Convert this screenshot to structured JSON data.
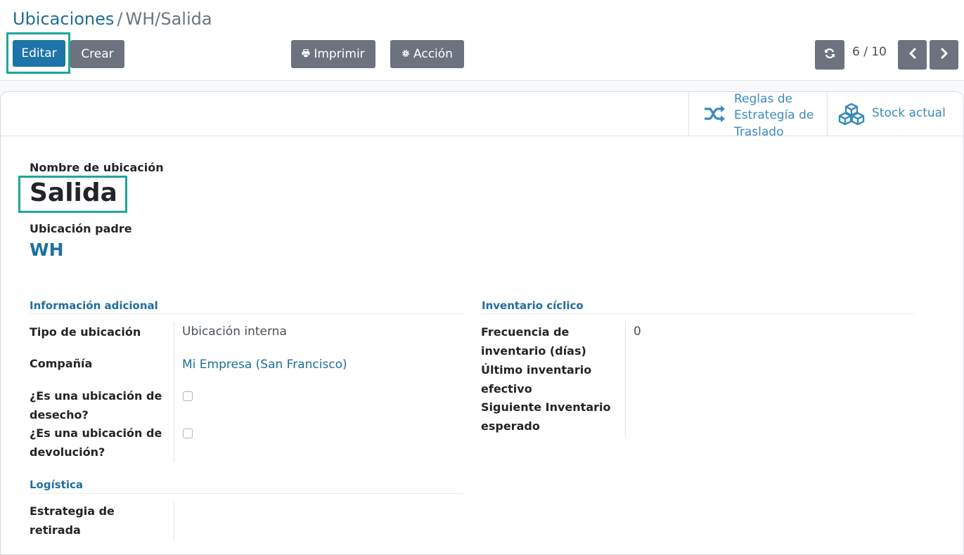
{
  "breadcrumb": {
    "parent": "Ubicaciones",
    "separator": "/",
    "current": "WH/Salida"
  },
  "toolbar": {
    "edit_label": "Editar",
    "create_label": "Crear",
    "print_label": "Imprimir",
    "action_label": "Acción",
    "print_icon": "printer-icon",
    "action_icon": "gear-icon"
  },
  "pager": {
    "value": "6 / 10",
    "refresh_icon": "refresh-icon",
    "prev_icon": "chevron-left-icon",
    "next_icon": "chevron-right-icon"
  },
  "smart_buttons": {
    "putaway_label": "Reglas de Estrategía de Traslado",
    "putaway_icon": "shuffle-icon",
    "stock_label": "Stock actual",
    "stock_icon": "cubes-icon"
  },
  "form": {
    "name_label": "Nombre de ubicación",
    "name_value": "Salida",
    "parent_label": "Ubicación padre",
    "parent_value": "WH"
  },
  "info_group": {
    "title": "Información adicional",
    "location_type_label": "Tipo de ubicación",
    "location_type_value": "Ubicación interna",
    "company_label": "Compañía",
    "company_value": "Mi Empresa (San Francisco)",
    "scrap_label": "¿Es una ubicación de desecho?",
    "scrap_checked": false,
    "return_label": "¿Es una ubicación de devolución?",
    "return_checked": false
  },
  "cyclic_group": {
    "title": "Inventario cíclico",
    "frequency_label": "Frecuencia de inventario (días)",
    "frequency_value": "0",
    "last_inventory_label": "Último inventario efectivo",
    "next_inventory_label": "Siguiente Inventario esperado"
  },
  "logistics_group": {
    "title": "Logística",
    "removal_label": "Estrategia de retirada"
  },
  "colors": {
    "primary": "#1d74a8",
    "secondary": "#6c737f",
    "link": "#1d6fa0",
    "highlight": "#1fa59d"
  }
}
